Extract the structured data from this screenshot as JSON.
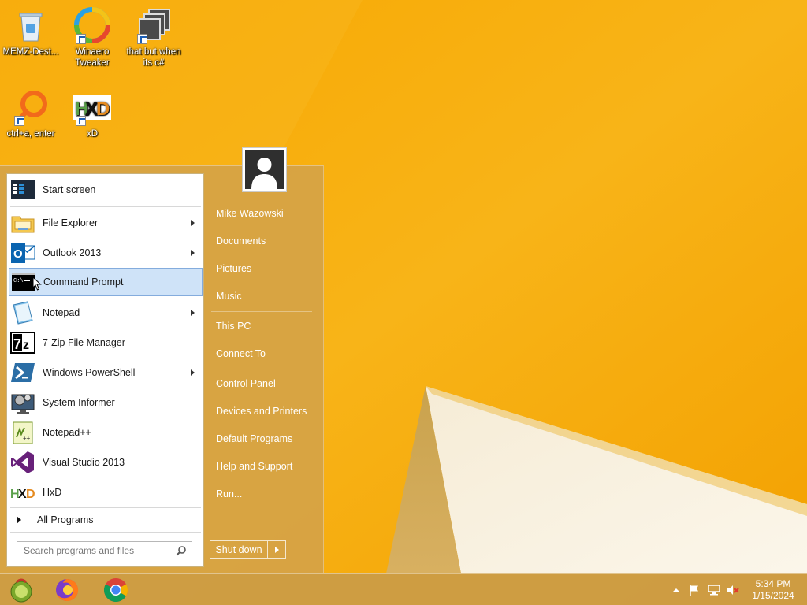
{
  "desktop": {
    "icons": [
      {
        "label": "MEMZ-Dest...",
        "icon": "recycle-bin-icon"
      },
      {
        "label": "Winaero Tweaker",
        "icon": "winaero-icon"
      },
      {
        "label": "that but when its c#",
        "icon": "stacked-windows-icon"
      },
      {
        "label": "ctrl+a, enter",
        "icon": "magnifier-ring-icon"
      },
      {
        "label": "xD",
        "icon": "hxd-icon"
      }
    ]
  },
  "start_menu": {
    "programs": [
      {
        "label": "Start screen",
        "icon": "start-screen-icon",
        "submenu": false
      },
      {
        "label": "File Explorer",
        "icon": "folder-icon",
        "submenu": true
      },
      {
        "label": "Outlook 2013",
        "icon": "outlook-icon",
        "submenu": true
      },
      {
        "label": "Command Prompt",
        "icon": "cmd-icon",
        "submenu": false,
        "selected": true
      },
      {
        "label": "Notepad",
        "icon": "notepad-icon",
        "submenu": true
      },
      {
        "label": "7-Zip File Manager",
        "icon": "7zip-icon",
        "submenu": false
      },
      {
        "label": "Windows PowerShell",
        "icon": "powershell-icon",
        "submenu": true
      },
      {
        "label": "System Informer",
        "icon": "system-informer-icon",
        "submenu": false
      },
      {
        "label": "Notepad++",
        "icon": "notepadpp-icon",
        "submenu": false
      },
      {
        "label": "Visual Studio 2013",
        "icon": "visual-studio-icon",
        "submenu": false
      },
      {
        "label": "HxD",
        "icon": "hxd-icon",
        "submenu": false
      }
    ],
    "all_programs": "All Programs",
    "search_placeholder": "Search programs and files",
    "right_items": [
      "Mike Wazowski",
      "Documents",
      "Pictures",
      "Music",
      "This PC",
      "Connect To",
      "Control Panel",
      "Devices and Printers",
      "Default Programs",
      "Help and Support",
      "Run..."
    ],
    "shutdown_label": "Shut down"
  },
  "taskbar": {
    "pinned": [
      "classic-shell-start-icon",
      "firefox-icon",
      "chrome-icon"
    ],
    "tray": [
      "show-hidden-icons-icon",
      "action-center-flag-icon",
      "network-icon",
      "volume-muted-icon"
    ],
    "time": "5:34 PM",
    "date": "1/15/2024"
  },
  "colors": {
    "wallpaper": "#f6a800",
    "menu_bg": "#d5a246",
    "selection": "#cfe3f8"
  }
}
